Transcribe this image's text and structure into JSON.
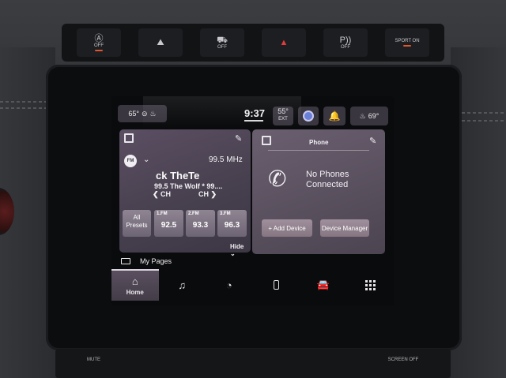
{
  "hardware_buttons": [
    {
      "name": "traction-off",
      "symbol": "Ⓐ",
      "label": "OFF"
    },
    {
      "name": "hill-descent",
      "symbol": "⛰",
      "label": ""
    },
    {
      "name": "lane-keep-off",
      "symbol": "⛟",
      "label": "OFF"
    },
    {
      "name": "hazard",
      "symbol": "▲",
      "label": ""
    },
    {
      "name": "park-assist-off",
      "symbol": "P))",
      "label": "OFF"
    },
    {
      "name": "sport",
      "symbol": "",
      "label": "SPORT ON"
    }
  ],
  "status_bar": {
    "driver_temp": "65°",
    "clock": "9:37",
    "ext_temp": "55°",
    "ext_label": "EXT",
    "passenger_temp": "69°"
  },
  "radio": {
    "band_badge": "FM",
    "frequency": "99.5 MHz",
    "song": "ck TheTe",
    "station": "99.5 The Wolf * 99....",
    "ch_prev": "CH",
    "ch_next": "CH",
    "all_presets": "All Presets",
    "presets": [
      {
        "label": "1.FM",
        "value": "92.5"
      },
      {
        "label": "2.FM",
        "value": "93.3"
      },
      {
        "label": "3.FM",
        "value": "96.3"
      }
    ],
    "hide_label": "Hide"
  },
  "phone": {
    "title": "Phone",
    "message_line1": "No Phones",
    "message_line2": "Connected",
    "add_device": "+ Add Device",
    "device_manager": "Device Manager"
  },
  "my_pages": "My Pages",
  "nav": {
    "home_label": "Home"
  },
  "bottom_panel": {
    "mute": "MUTE",
    "screen_off": "SCREEN OFF"
  }
}
